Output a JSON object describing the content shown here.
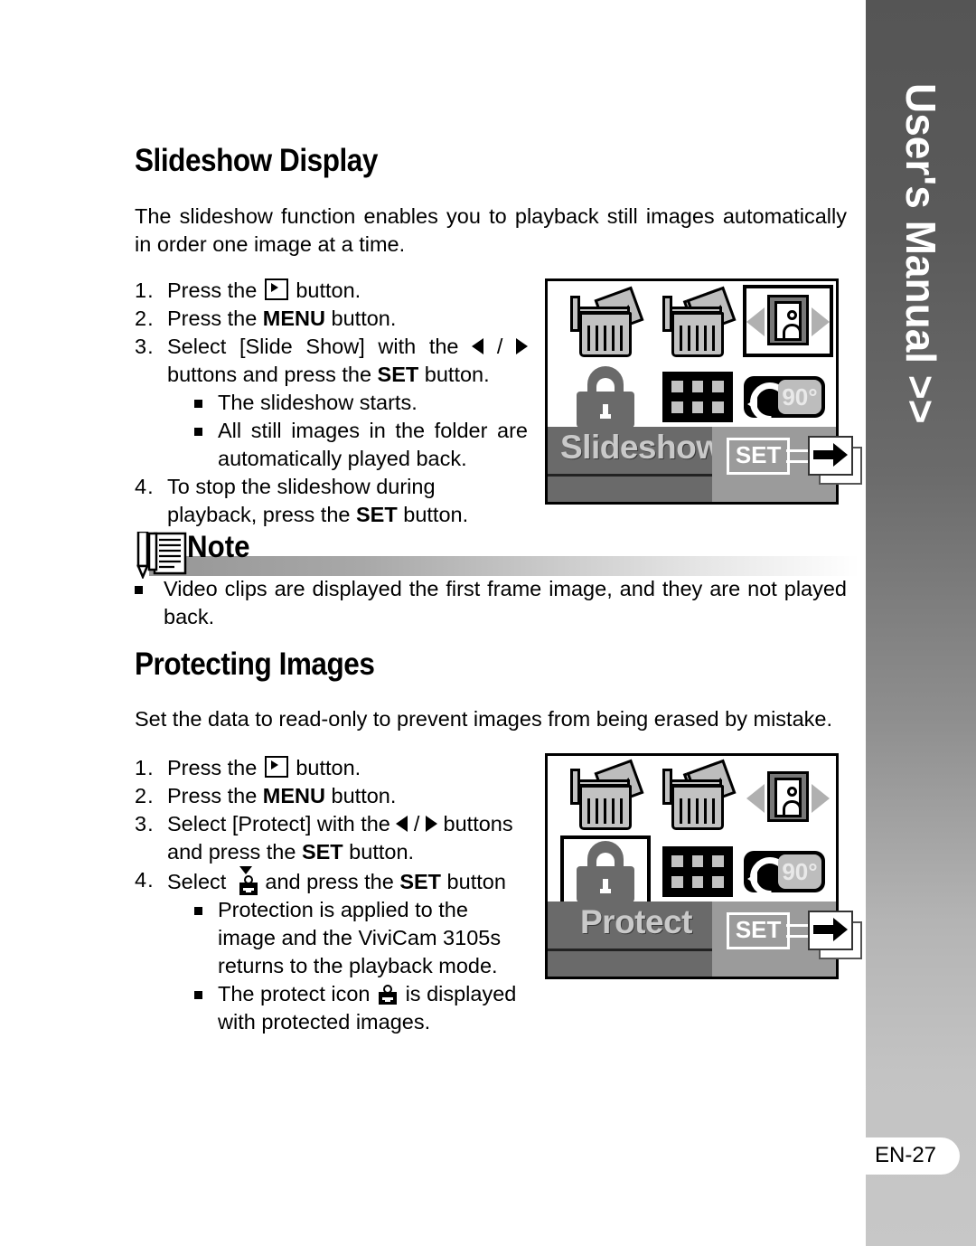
{
  "side_tab": {
    "label": "User's Manual >>",
    "page_number": "EN-27",
    "gradient_top_color": "#555555",
    "gradient_bottom_color": "#c7c7c7"
  },
  "sections": [
    {
      "heading": "Slideshow Display",
      "intro": "The slideshow function enables you to playback still images automatically in order one image at a time.",
      "steps": [
        {
          "num": "1.",
          "text_pre": "Press the ",
          "icon": "playback-button-icon",
          "text_post": " button."
        },
        {
          "num": "2.",
          "text_pre": "Press the ",
          "bold": "MENU",
          "text_post": " button."
        },
        {
          "num": "3.",
          "text_pre": "Select [Slide Show] with the ",
          "icon": "left-right-arrow-icons",
          "text_mid": " buttons and press the ",
          "bold": "SET",
          "text_post": " button.",
          "subs": [
            "The slideshow starts.",
            "All still images in the folder are automatically played back."
          ]
        },
        {
          "num": "4.",
          "text_pre": "To stop the slideshow during playback, press the ",
          "bold": "SET",
          "text_post": " button."
        }
      ],
      "lcd": {
        "title": "Slideshow",
        "set_label": "SET",
        "selected_index": 2,
        "rotate_label": "90°",
        "icons": [
          "delete-single-icon",
          "delete-all-icon",
          "single-image-playback-icon",
          "protect-lock-icon",
          "thumbnail-grid-icon",
          "rotate-90-icon"
        ]
      }
    },
    {
      "heading": "Protecting Images",
      "intro": "Set the data to read-only to prevent images from being erased by mistake.",
      "steps": [
        {
          "num": "1.",
          "text_pre": "Press the ",
          "icon": "playback-button-icon",
          "text_post": " button."
        },
        {
          "num": "2.",
          "text_pre": "Press the ",
          "bold": "MENU",
          "text_post": " button."
        },
        {
          "num": "3.",
          "text_pre": "Select [Protect] with the ",
          "icon": "left-right-arrow-icons",
          "text_mid": " buttons and press the ",
          "bold": "SET",
          "text_post": " button."
        },
        {
          "num": "4.",
          "text_pre": "Select ",
          "icon": "key-select-icon",
          "text_mid": " and press the ",
          "bold": "SET",
          "text_post": " button",
          "subs": [
            "Protection is applied to the image and the ViviCam 3105s returns to the playback mode.",
            "The protect icon  is displayed with protected images."
          ]
        }
      ],
      "lcd": {
        "title": "Protect",
        "set_label": "SET",
        "selected_index": 3,
        "rotate_label": "90°",
        "icons": [
          "delete-single-icon",
          "delete-all-icon",
          "single-image-playback-icon",
          "protect-lock-icon",
          "thumbnail-grid-icon",
          "rotate-90-icon"
        ]
      }
    }
  ],
  "note": {
    "label": "Note",
    "icon": "note-pencil-document-icon",
    "bullets": [
      "Video clips are displayed the first frame image, and they are not played back."
    ]
  }
}
